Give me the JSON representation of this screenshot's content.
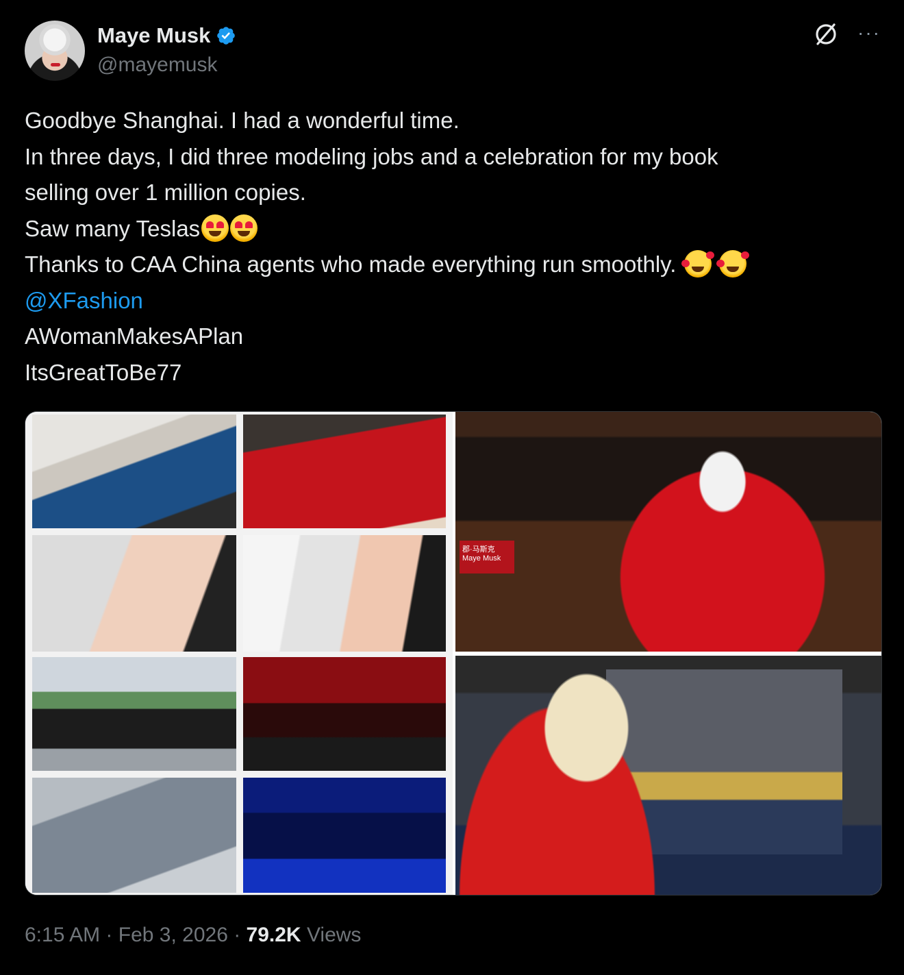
{
  "author": {
    "name": "Maye Musk",
    "handle": "@mayemusk",
    "verified": true,
    "verified_color": "#1d9bf0"
  },
  "actions": {
    "grok_icon": "grok-icon",
    "more_label": "···"
  },
  "tweet": {
    "lines": [
      "Goodbye Shanghai. I had a wonderful time.",
      "In three days, I did three modeling jobs and a celebration for my book",
      "selling over 1 million copies.",
      "Saw many Teslas",
      "Thanks to CAA China agents who made everything run smoothly. ",
      "@XFashion",
      "AWomanMakesAPlan",
      "ItsGreatToBe77"
    ],
    "emojis": {
      "teslas": [
        "heart-eyes-emoji",
        "heart-eyes-emoji"
      ],
      "thanks": [
        "smiling-face-with-hearts-emoji",
        "smiling-face-with-hearts-emoji"
      ]
    }
  },
  "media": {
    "bookstore_sign": "郡·马斯克\nMaye Musk"
  },
  "meta": {
    "time": "6:15 AM",
    "sep1": " · ",
    "date": "Feb 3, 2026",
    "sep2": " · ",
    "views_count": "79.2K",
    "views_label": " Views"
  },
  "colors": {
    "background": "#000000",
    "text": "#e7e9ea",
    "secondary": "#71767b",
    "link": "#1d9bf0"
  }
}
